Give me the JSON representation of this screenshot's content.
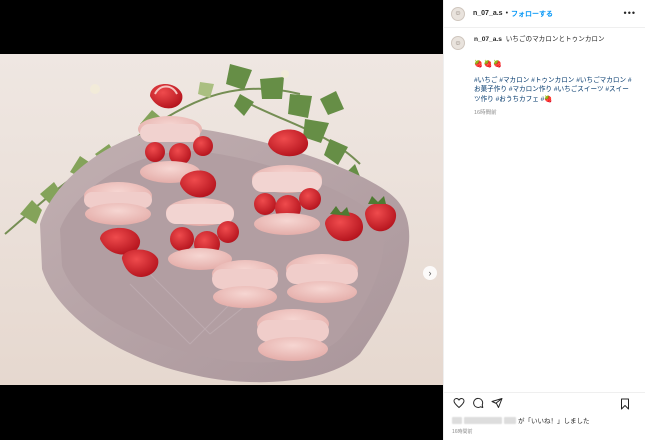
{
  "post": {
    "username": "n_07_a.s",
    "follow_label": "フォローする",
    "separator": "•",
    "more_label": "•••",
    "avatar_glyph": "☺",
    "caption_title": "いちごのマカロンとトゥンカロン",
    "caption_emoji": "🍓🍓🍓",
    "hashtags": "#いちご #マカロン #トゥンカロン #いちごマカロン #お菓子作り #マカロン作り #いちごスイーツ #スイーツ作り #おうちカフェ #🍓",
    "caption_time": "16時間前",
    "likes_suffix": "が「いいね！」しました",
    "liked_time": "16時間前"
  },
  "media": {
    "next_arrow": "›",
    "carousel_count": 4,
    "carousel_active": 0
  },
  "colors": {
    "link_blue": "#0095f6",
    "hashtag": "#00376b",
    "tray": "#b7a3a6",
    "macaron": "#efc3bf",
    "strawberry": "#d7262f"
  },
  "icons": {
    "heart": "heart-icon",
    "comment": "comment-icon",
    "share": "share-icon",
    "bookmark": "bookmark-icon"
  }
}
